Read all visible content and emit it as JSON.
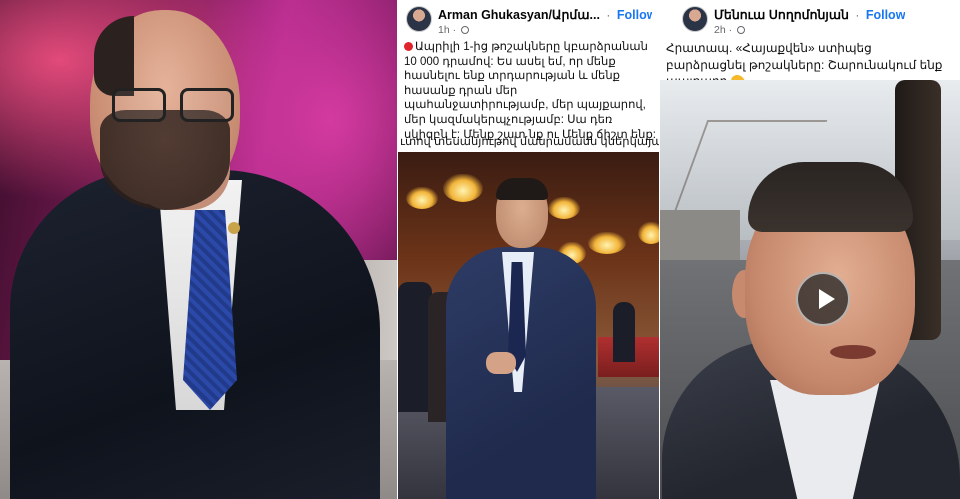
{
  "post_left": {
    "author": "Arman Ghukasyan/Արմա...",
    "follow_label": "Follow",
    "time": "1h",
    "text_line1": "Ապրիլի 1-ից թոշակները կբարձրանան 10 000 դրամով: Ես ասել եմ, որ մենք հասնելու ենք տրդարության և մենք հասանք դրան մեր պահանջատիրությամբ, մեր պայքարով, մեր կազմակերպչությամբ: Սա դեռ սկիզբն է: Մենք շատ նք ու Մենք ճիշտ ենք:",
    "text_line2": "ւտով տեսանյութով մանրամասն կներկայացնեմ:"
  },
  "post_right": {
    "close_icon": "close-icon",
    "author": "Մենուա Սողոմոնյան",
    "follow_label": "Follow",
    "time": "2h",
    "text": "Հրատապ. «Հայաքվեն» ստիպեց բարձրացնել թոշակները: Շարունակում ենք պայքարը",
    "emoji": "flexed-biceps-icon"
  },
  "colors": {
    "follow_blue": "#1877f2",
    "meta_gray": "#65676b",
    "red_dot": "#e0242b"
  }
}
